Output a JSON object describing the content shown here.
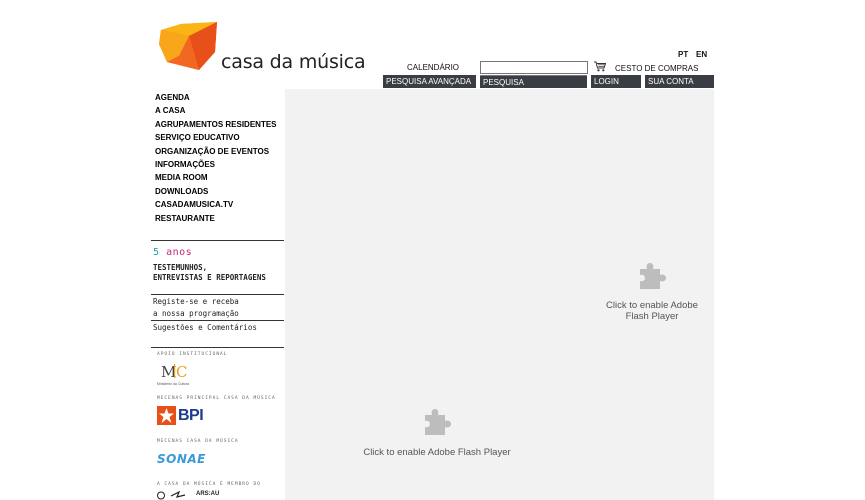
{
  "logo": {
    "text": "casa da música"
  },
  "lang": {
    "pt": "PT",
    "en": "EN"
  },
  "header": {
    "calendar": "CALENDÁRIO",
    "search_value": "",
    "search_button": "PESQUISA",
    "advanced_search": "PESQUISA AVANÇADA",
    "cart": "CESTO DE COMPRAS",
    "login": "LOGIN",
    "account": "SUA CONTA"
  },
  "nav": {
    "items": [
      "AGENDA",
      "A CASA",
      "AGRUPAMENTOS RESIDENTES",
      "SERVIÇO EDUCATIVO",
      "ORGANIZAÇÃO DE EVENTOS",
      "INFORMAÇÕES",
      "MEDIA ROOM",
      "DOWNLOADS",
      "CASADAMUSICA.TV",
      "RESTAURANTE"
    ]
  },
  "promo": {
    "anos_number": "5",
    "anos_word": "anos",
    "line1": "TESTEMUNHOS,",
    "line2": "ENTREVISTAS E REPORTAGENS"
  },
  "links": {
    "register_line1": "Registe-se e receba",
    "register_line2": "a nossa programação",
    "suggestions": "Sugestões e Comentários"
  },
  "sponsors": {
    "apoio_label": "APOIO INSTITUCIONAL",
    "apoio_name": "Ministério da Cultura",
    "mecenas_principal_label": "MECENAS PRINCIPAL CASA DA MÚSICA",
    "bpi": "BPI",
    "mecenas_label": "MECENAS CASA DA MÚSICA",
    "sonae": "SONAE",
    "membro_label": "A CASA DA MÚSICA É MEMBRO DO",
    "member_logo": "ARS:AU"
  },
  "flash": {
    "message_right_l1": "Click to enable Adobe",
    "message_right_l2": "Flash Player",
    "message_left": "Click to enable Adobe Flash Player"
  },
  "colors": {
    "logo_orange": "#f47b20",
    "logo_yellow": "#fbb416",
    "logo_red": "#e8501a",
    "dark_bar": "#3a3e44",
    "flash_bg": "#f2f2f2",
    "bpi_orange": "#e8501a",
    "sonae_blue": "#3a9ad9"
  }
}
